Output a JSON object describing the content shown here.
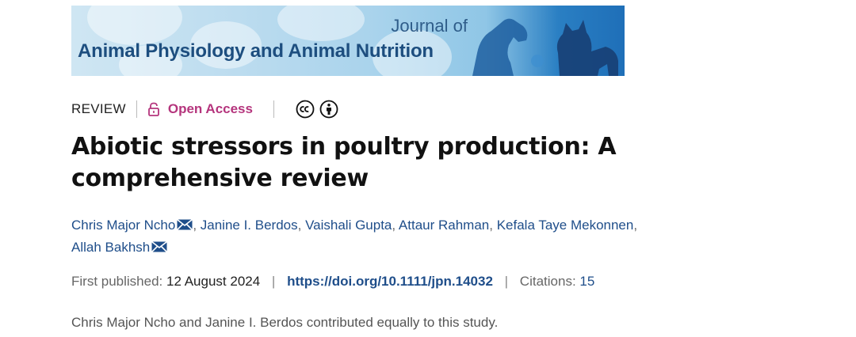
{
  "banner": {
    "journal_of": "Journal of",
    "title": "Animal Physiology and Animal Nutrition"
  },
  "meta": {
    "type": "REVIEW",
    "open_access": "Open Access",
    "license_icons": [
      "creative-commons-icon",
      "attribution-icon"
    ]
  },
  "title": "Abiotic stressors in poultry production: A comprehensive review",
  "authors": [
    {
      "name": "Chris Major Ncho",
      "email": true
    },
    {
      "name": "Janine I. Berdos",
      "email": false
    },
    {
      "name": "Vaishali Gupta",
      "email": false
    },
    {
      "name": "Attaur Rahman",
      "email": false
    },
    {
      "name": "Kefala Taye Mekonnen",
      "email": false
    },
    {
      "name": "Allah Bakhsh",
      "email": true
    }
  ],
  "publication": {
    "first_published_label": "First published:",
    "first_published_date": "12 August 2024",
    "doi": "https://doi.org/10.1111/jpn.14032",
    "citations_label": "Citations:",
    "citations_value": "15"
  },
  "note": "Chris Major Ncho and Janine I. Berdos contributed equally to this study.",
  "colors": {
    "open_access": "#b5357d",
    "link": "#1f4e8a",
    "banner_text": "#1d4e7f"
  }
}
